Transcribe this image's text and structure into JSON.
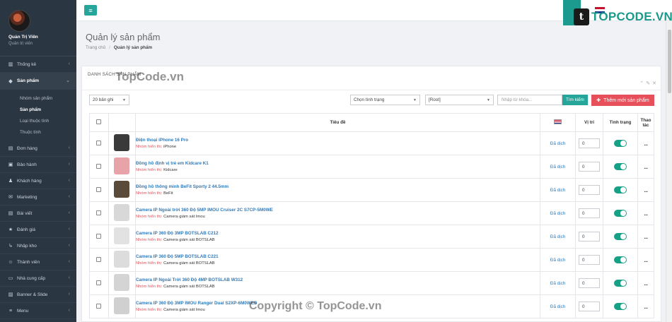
{
  "sidebar": {
    "user_name": "Quản Trị Viên",
    "user_role": "Quản trị viên",
    "items_top": [
      {
        "label": "Thống kê",
        "icon": "chart-icon"
      }
    ],
    "active": {
      "label": "Sản phẩm",
      "icon": "cube-icon"
    },
    "sub_items": [
      "Nhóm sản phẩm",
      "Sản phẩm",
      "Loại thuộc tính",
      "Thuộc tính"
    ],
    "items_bottom": [
      {
        "label": "Đơn hàng",
        "icon": "cart-icon"
      },
      {
        "label": "Bảo hành",
        "icon": "shield-icon"
      },
      {
        "label": "Khách hàng",
        "icon": "users-icon"
      },
      {
        "label": "Marketing",
        "icon": "megaphone-icon"
      },
      {
        "label": "Bài viết",
        "icon": "document-icon"
      },
      {
        "label": "Đánh giá",
        "icon": "star-icon"
      },
      {
        "label": "Nhập kho",
        "icon": "import-icon"
      },
      {
        "label": "Thành viên",
        "icon": "member-icon"
      },
      {
        "label": "Nhà cung cấp",
        "icon": "truck-icon"
      },
      {
        "label": "Banner & Slide",
        "icon": "image-icon"
      },
      {
        "label": "Menu",
        "icon": "menu-icon"
      }
    ]
  },
  "header": {
    "logo_text": "TOPCODE.VN",
    "page_title": "Quản lý sản phẩm",
    "breadcrumb_home": "Trang chủ",
    "breadcrumb_current": "Quản lý sản phẩm"
  },
  "panel": {
    "heading": "DANH SÁCH SẢN PHẨM",
    "page_size": "20 bản ghi",
    "status_filter": "Chọn tình trạng",
    "category_filter": "[Root]",
    "search_placeholder": "Nhập từ khóa...",
    "search_button": "Tìm kiếm",
    "add_button": "Thêm mới sản phẩm"
  },
  "table": {
    "headers": {
      "title": "Tiêu đề",
      "position": "Vị trí",
      "status": "Tình trạng",
      "actions": "Thao tác"
    },
    "group_label": "Nhóm hiển thị:",
    "translated_label": "Đã dịch",
    "rows": [
      {
        "name": "Điện thoại iPhone 16 Pro",
        "group": "iPhone",
        "position": "0",
        "thumb": "#3a3a3a"
      },
      {
        "name": "Đồng hồ định vị trẻ em Kidcare K1",
        "group": "Kidcare",
        "position": "0",
        "thumb": "#e8a3a8"
      },
      {
        "name": "Đồng hồ thông minh BeFit Sporty 2 44.5mm",
        "group": "BeFit",
        "position": "0",
        "thumb": "#5a4a3a"
      },
      {
        "name": "Camera IP Ngoài trời 360 Độ 5MP IMOU Cruiser 2C S7CP-5M0WE",
        "group": "Camera giám sát Imou",
        "position": "0",
        "thumb": "#d8d8d8"
      },
      {
        "name": "Camera IP 360 Độ 3MP BOTSLAB C212",
        "group": "Camera giám sát BOTSLAB",
        "position": "0",
        "thumb": "#e2e2e2"
      },
      {
        "name": "Camera IP 360 Độ 5MP BOTSLAB C221",
        "group": "Camera giám sát BOTSLAB",
        "position": "0",
        "thumb": "#dcdcdc"
      },
      {
        "name": "Camera IP Ngoài Trời 360 Độ 4MP BOTSLAB W312",
        "group": "Camera giám sát BOTSLAB",
        "position": "0",
        "thumb": "#d4d4d4"
      },
      {
        "name": "Camera IP 360 Độ 3MP IMOU Ranger Dual S2XP-6M0WED",
        "group": "Camera giám sát Imou",
        "position": "0",
        "thumb": "#d0d0d0"
      }
    ]
  },
  "watermarks": {
    "top": "TopCode.vn",
    "bottom": "Copyright © TopCode.vn"
  }
}
